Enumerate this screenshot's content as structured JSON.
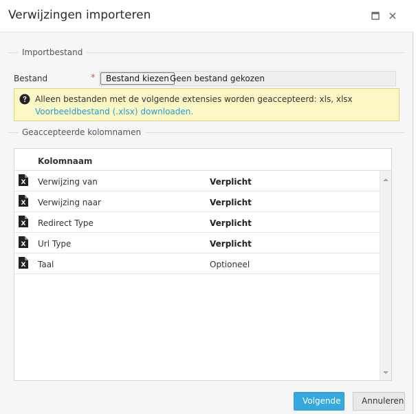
{
  "dialog": {
    "title": "Verwijzingen importeren"
  },
  "import_section": {
    "legend": "Importbestand",
    "file_label": "Bestand",
    "required_mark": "*",
    "file_button": "Bestand kiezen",
    "file_status": "Geen bestand gekozen"
  },
  "info": {
    "text": "Alleen bestanden met de volgende extensies worden geaccepteerd: xls, xlsx",
    "link": "Voorbeeldbestand (.xlsx) downloaden."
  },
  "columns_section": {
    "legend": "Geaccepteerde kolomnamen",
    "header": "Kolomnaam",
    "rows": [
      {
        "name": "Verwijzing van",
        "requirement": "Verplicht",
        "bold": true
      },
      {
        "name": "Verwijzing naar",
        "requirement": "Verplicht",
        "bold": true
      },
      {
        "name": "Redirect Type",
        "requirement": "Verplicht",
        "bold": true
      },
      {
        "name": "Url Type",
        "requirement": "Verplicht",
        "bold": true
      },
      {
        "name": "Taal",
        "requirement": "Optioneel",
        "bold": false
      }
    ]
  },
  "footer": {
    "next_label": "Volgende",
    "cancel_label": "Annuleren"
  },
  "colors": {
    "primary": "#35a8e0",
    "link": "#1e9fd6",
    "info_bg": "#fbf7c5",
    "required": "#d9534f"
  }
}
